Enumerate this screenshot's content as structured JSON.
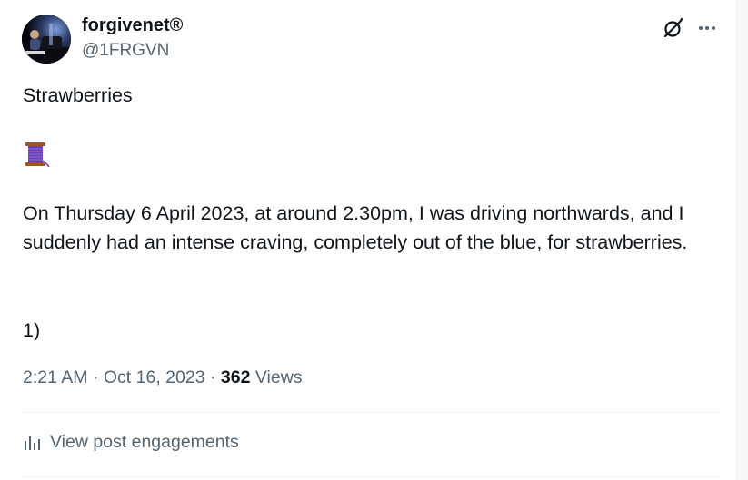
{
  "author": {
    "display_name": "forgivenet®",
    "handle": "@1FRGVN",
    "avatar_icon": "pianist-photo"
  },
  "header_actions": {
    "grok_icon": "grok-icon",
    "more_icon": "more-icon",
    "more_label": "···"
  },
  "post": {
    "title": "Strawberries",
    "emoji": "thread-spool",
    "body": "On Thursday 6 April 2023, at around 2.30pm, I was driving northwards, and I suddenly had an intense craving, completely out of the blue, for strawberries.",
    "number": "1)"
  },
  "meta": {
    "time": "2:21 AM",
    "separator": "·",
    "date": "Oct 16, 2023",
    "views_count": "362",
    "views_label": "Views"
  },
  "engagements": {
    "icon": "bar-chart-icon",
    "label": "View post engagements"
  },
  "colors": {
    "text_primary": "#0f1419",
    "text_secondary": "#536471",
    "divider": "#eff3f4"
  }
}
